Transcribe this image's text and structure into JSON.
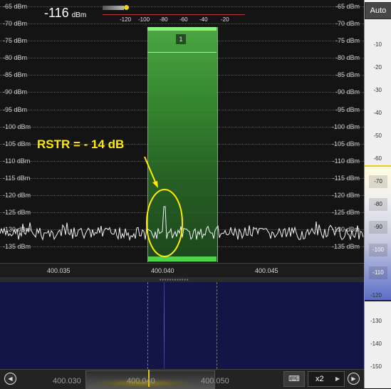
{
  "spectrum": {
    "level_readout": "-116",
    "level_unit": "dBm",
    "db_labels": [
      "-65 dBm",
      "-70 dBm",
      "-75 dBm",
      "-80 dBm",
      "-85 dBm",
      "-90 dBm",
      "-95 dBm",
      "-100 dBm",
      "-105 dBm",
      "-110 dBm",
      "-115 dBm",
      "-120 dBm",
      "-125 dBm",
      "-130 dBm",
      "-135 dBm"
    ],
    "mini_scale_ticks": [
      "-120",
      "-100",
      "-80",
      "-60",
      "-40",
      "-20"
    ],
    "vfo_number": "1",
    "annotation": "RSTR = - 14 dB",
    "freq_labels": [
      "400.035",
      "400.040",
      "400.045"
    ]
  },
  "bottom_bar": {
    "left_arrow": "◀",
    "right_arrow": "▶",
    "freq_labels": [
      "400.030",
      "400.040",
      "400.050"
    ],
    "keyboard_icon": "keyboard-icon",
    "zoom": "x2",
    "zoom_arrow": "▶"
  },
  "right_panel": {
    "auto_label": "Auto",
    "scale": [
      "-10",
      "-20",
      "-30",
      "-40",
      "-50",
      "-60",
      "-70",
      "-80",
      "-90",
      "-100",
      "-110",
      "-120",
      "-130",
      "-140",
      "-150"
    ]
  },
  "colors": {
    "filter_band": "#3d9e35",
    "annotation": "#ffea00",
    "waterfall_bg": "#121546"
  }
}
